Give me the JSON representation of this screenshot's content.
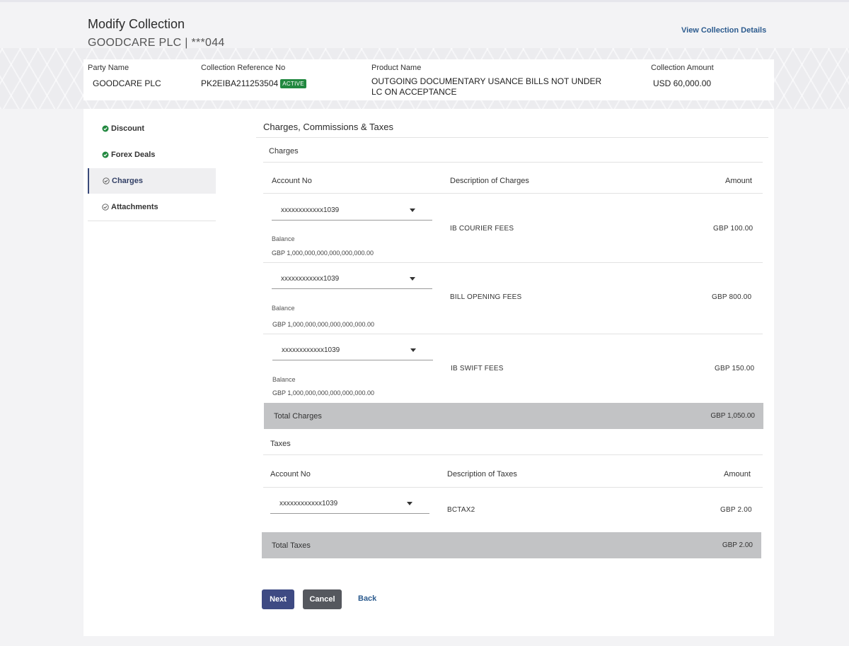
{
  "header": {
    "title": "Modify Collection",
    "subtitle": "GOODCARE PLC | ***044",
    "view_link": "View Collection Details"
  },
  "summary": {
    "party_name_label": "Party Name",
    "party_name": "GOODCARE PLC",
    "ref_label": "Collection Reference No",
    "ref_value": "PK2EIBA211253504",
    "status_badge": "ACTIVE",
    "product_label": "Product Name",
    "product_line1": "OUTGOING DOCUMENTARY USANCE BILLS NOT UNDER",
    "product_line2": "LC ON ACCEPTANCE",
    "amount_label": "Collection Amount",
    "amount_value": "USD 60,000.00"
  },
  "sidebar": {
    "items": [
      {
        "label": "Discount",
        "icon": "check-circle-filled-icon",
        "state": "done"
      },
      {
        "label": "Forex Deals",
        "icon": "check-circle-filled-icon",
        "state": "done"
      },
      {
        "label": "Charges",
        "icon": "check-circle-outline-icon",
        "state": "active"
      },
      {
        "label": "Attachments",
        "icon": "check-circle-outline-icon",
        "state": "pending"
      }
    ]
  },
  "section_title": "Charges, Commissions & Taxes",
  "charges": {
    "title": "Charges",
    "col_account": "Account No",
    "col_desc": "Description of Charges",
    "col_amount": "Amount",
    "rows": [
      {
        "account": "xxxxxxxxxxxx1039",
        "balance_label": "Balance",
        "balance": "GBP 1,000,000,000,000,000,000.00",
        "description": "IB COURIER FEES",
        "amount": "GBP 100.00"
      },
      {
        "account": "xxxxxxxxxxxx1039",
        "balance_label": "Balance",
        "balance": "GBP 1,000,000,000,000,000,000.00",
        "description": "BILL OPENING FEES",
        "amount": "GBP 800.00"
      },
      {
        "account": "xxxxxxxxxxxx1039",
        "balance_label": "Balance",
        "balance": "GBP 1,000,000,000,000,000,000.00",
        "description": "IB SWIFT FEES",
        "amount": "GBP 150.00"
      }
    ],
    "total_label": "Total Charges",
    "total_value": "GBP 1,050.00"
  },
  "taxes": {
    "title": "Taxes",
    "col_account": "Account No",
    "col_desc": "Description of Taxes",
    "col_amount": "Amount",
    "rows": [
      {
        "account": "xxxxxxxxxxxx1039",
        "description": "BCTAX2",
        "amount": "GBP 2.00"
      }
    ],
    "total_label": "Total Taxes",
    "total_value": "GBP 2.00"
  },
  "buttons": {
    "next": "Next",
    "cancel": "Cancel",
    "back": "Back"
  },
  "colors": {
    "primary_button": "#3e4a83",
    "cancel_button": "#55585e",
    "link": "#2c5b8e",
    "success": "#21883f",
    "total_bar": "#c2c3c5"
  }
}
